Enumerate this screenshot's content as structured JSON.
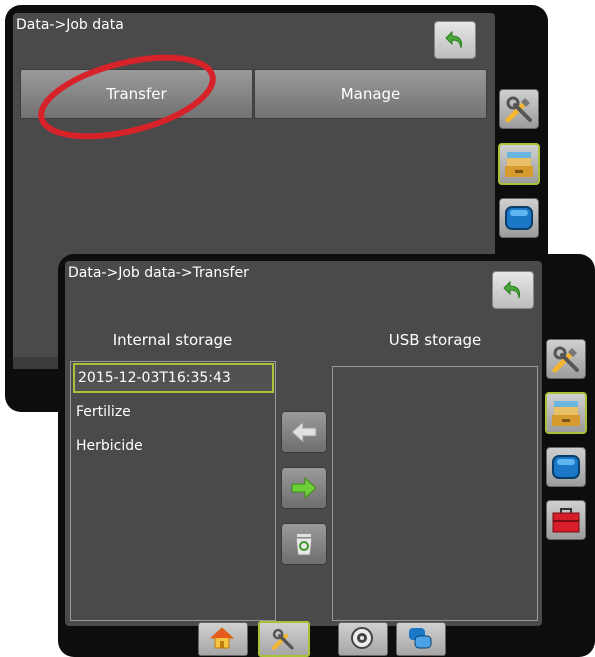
{
  "back_screen": {
    "title": "Data->Job data",
    "tabs": [
      {
        "label": "Transfer"
      },
      {
        "label": "Manage"
      }
    ]
  },
  "front_screen": {
    "title": "Data->Job data->Transfer",
    "internal_storage": {
      "label": "Internal storage",
      "items": [
        "2015-12-03T16:35:43",
        "Fertilize",
        "Herbicide"
      ],
      "selected_index": 0
    },
    "usb_storage": {
      "label": "USB storage",
      "items": []
    }
  },
  "colors": {
    "frame": "#0d0d0d",
    "screen": "#4a4a4a",
    "highlight": "#a8c23c",
    "annotation_ellipse": "#d7222a",
    "back_arrow": "#4aa83a"
  },
  "icons": {
    "back": "back-arrow-icon",
    "tools": "tools-icon",
    "data": "file-drawer-icon",
    "display": "display-icon",
    "toolbox": "toolbox-icon",
    "transfer_left": "arrow-left-icon",
    "transfer_right": "arrow-right-icon",
    "delete": "recycle-bin-icon",
    "home": "home-icon",
    "gps": "gps-icon",
    "screens": "screens-icon"
  }
}
